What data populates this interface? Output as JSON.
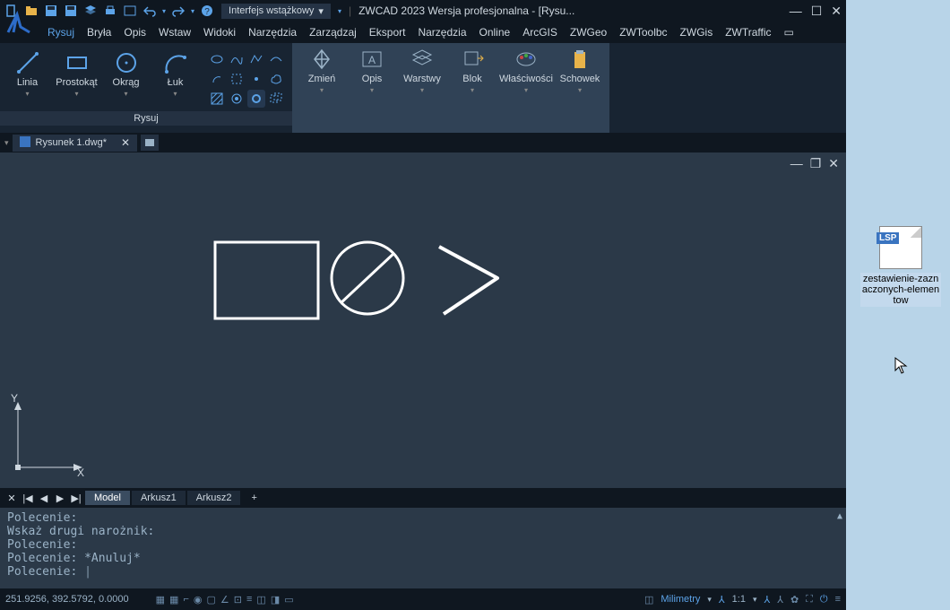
{
  "title": "ZWCAD 2023 Wersja profesjonalna - [Rysu...",
  "ui_mode": "Interfejs wstążkowy",
  "menu": [
    "Rysuj",
    "Bryła",
    "Opis",
    "Wstaw",
    "Widoki",
    "Narzędzia",
    "Zarządzaj",
    "Eksport",
    "Narzędzia",
    "Online",
    "ArcGIS",
    "ZWGeo",
    "ZWToolbc",
    "ZWGis",
    "ZWTraffic"
  ],
  "ribbon": {
    "title": "Rysuj",
    "big": [
      {
        "label": "Linia"
      },
      {
        "label": "Prostokąt"
      },
      {
        "label": "Okrąg"
      },
      {
        "label": "Łuk"
      }
    ],
    "tail": [
      {
        "label": "Zmień"
      },
      {
        "label": "Opis"
      },
      {
        "label": "Warstwy"
      },
      {
        "label": "Blok"
      },
      {
        "label": "Właściwości"
      },
      {
        "label": "Schowek"
      }
    ]
  },
  "file_tab": "Rysunek 1.dwg*",
  "layout_tabs": {
    "model": "Model",
    "sheets": [
      "Arkusz1",
      "Arkusz2"
    ]
  },
  "command_lines": [
    "Polecenie:",
    "Wskaż drugi narożnik:",
    "Polecenie:",
    "Polecenie: *Anuluj*",
    "Polecenie: "
  ],
  "axis": {
    "x": "X",
    "y": "Y"
  },
  "status": {
    "coords": "251.9256, 392.5792, 0.0000",
    "units": "Milimetry",
    "scale": "1:1"
  },
  "desktop_file": {
    "tag": "LSP",
    "name": "zestawienie-zaznaczonych-elementow"
  }
}
